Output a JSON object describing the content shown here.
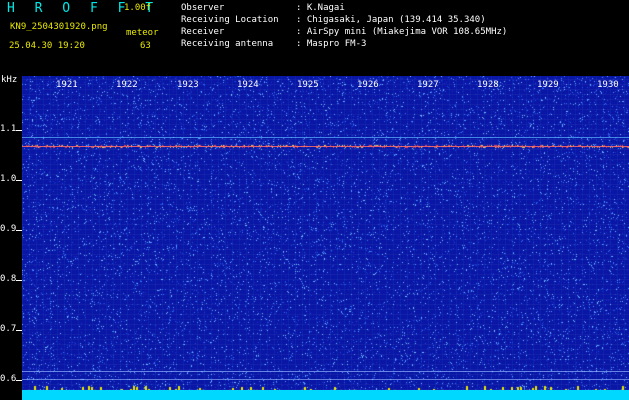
{
  "header": {
    "app_name": "H R O F F T",
    "version": "1.00f",
    "filename": "KN9_2504301920.png",
    "timestamp": "25.04.30 19:20",
    "meteor_label": "meteor",
    "meteor_count": "63"
  },
  "info": {
    "observer_label": "Observer",
    "observer_value": ": K.Nagai",
    "location_label": "Receiving Location",
    "location_value": ": Chigasaki, Japan (139.414 35.340)",
    "receiver_label": "Receiver",
    "receiver_value": ": AirSpy mini (Miakejima VOR 108.65MHz)",
    "antenna_label": "Receiving antenna",
    "antenna_value": ": Maspro FM-3"
  },
  "spectrogram": {
    "y_unit": "kHz",
    "y_ticks": [
      "1.1",
      "1.0",
      "0.9",
      "0.8",
      "0.7",
      "0.6"
    ],
    "x_ticks": [
      "1921",
      "1922",
      "1923",
      "1924",
      "1925",
      "1926",
      "1927",
      "1928",
      "1929",
      "1930"
    ],
    "colors": {
      "background": "#0a16a6",
      "noise": "#3a78ff",
      "carrier": "#ff5050",
      "label": "#ffffff",
      "accent": "#e8e800",
      "brand": "#00e8e8",
      "level_bar": "#00d8ff"
    }
  }
}
